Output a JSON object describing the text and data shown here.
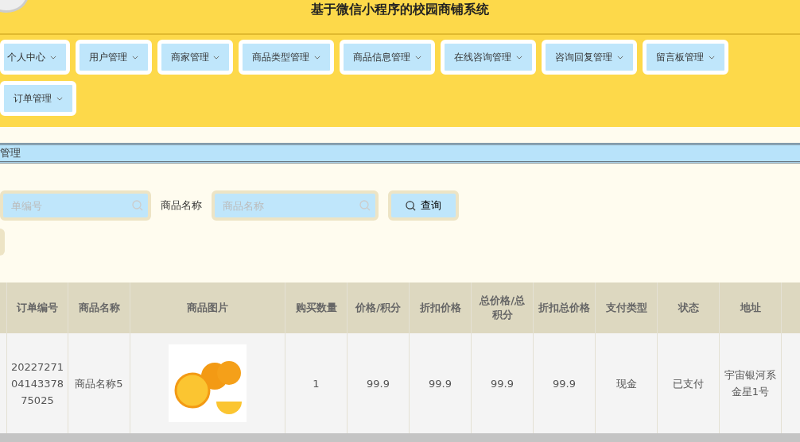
{
  "header": {
    "title": "基于微信小程序的校园商铺系统"
  },
  "menu": [
    {
      "label": "个人中心"
    },
    {
      "label": "用户管理"
    },
    {
      "label": "商家管理"
    },
    {
      "label": "商品类型管理"
    },
    {
      "label": "商品信息管理"
    },
    {
      "label": "在线咨询管理"
    },
    {
      "label": "咨询回复管理"
    },
    {
      "label": "留言板管理"
    },
    {
      "label": "订单管理"
    }
  ],
  "breadcrumb": "管理",
  "search": {
    "field_1": {
      "placeholder": "单编号"
    },
    "field_2": {
      "label": "商品名称",
      "placeholder": "商品名称"
    },
    "button": "查询"
  },
  "table": {
    "columns": [
      "订单编号",
      "商品名称",
      "商品图片",
      "购买数量",
      "价格/积分",
      "折扣价格",
      "总价格/总积分",
      "折扣总价格",
      "支付类型",
      "状态",
      "地址"
    ],
    "rows": [
      {
        "cells": [
          "202272710414337875025",
          "商品名称5",
          "",
          "1",
          "99.9",
          "99.9",
          "99.9",
          "99.9",
          "现金",
          "已支付",
          "宇宙银河系金星1号"
        ]
      }
    ]
  }
}
